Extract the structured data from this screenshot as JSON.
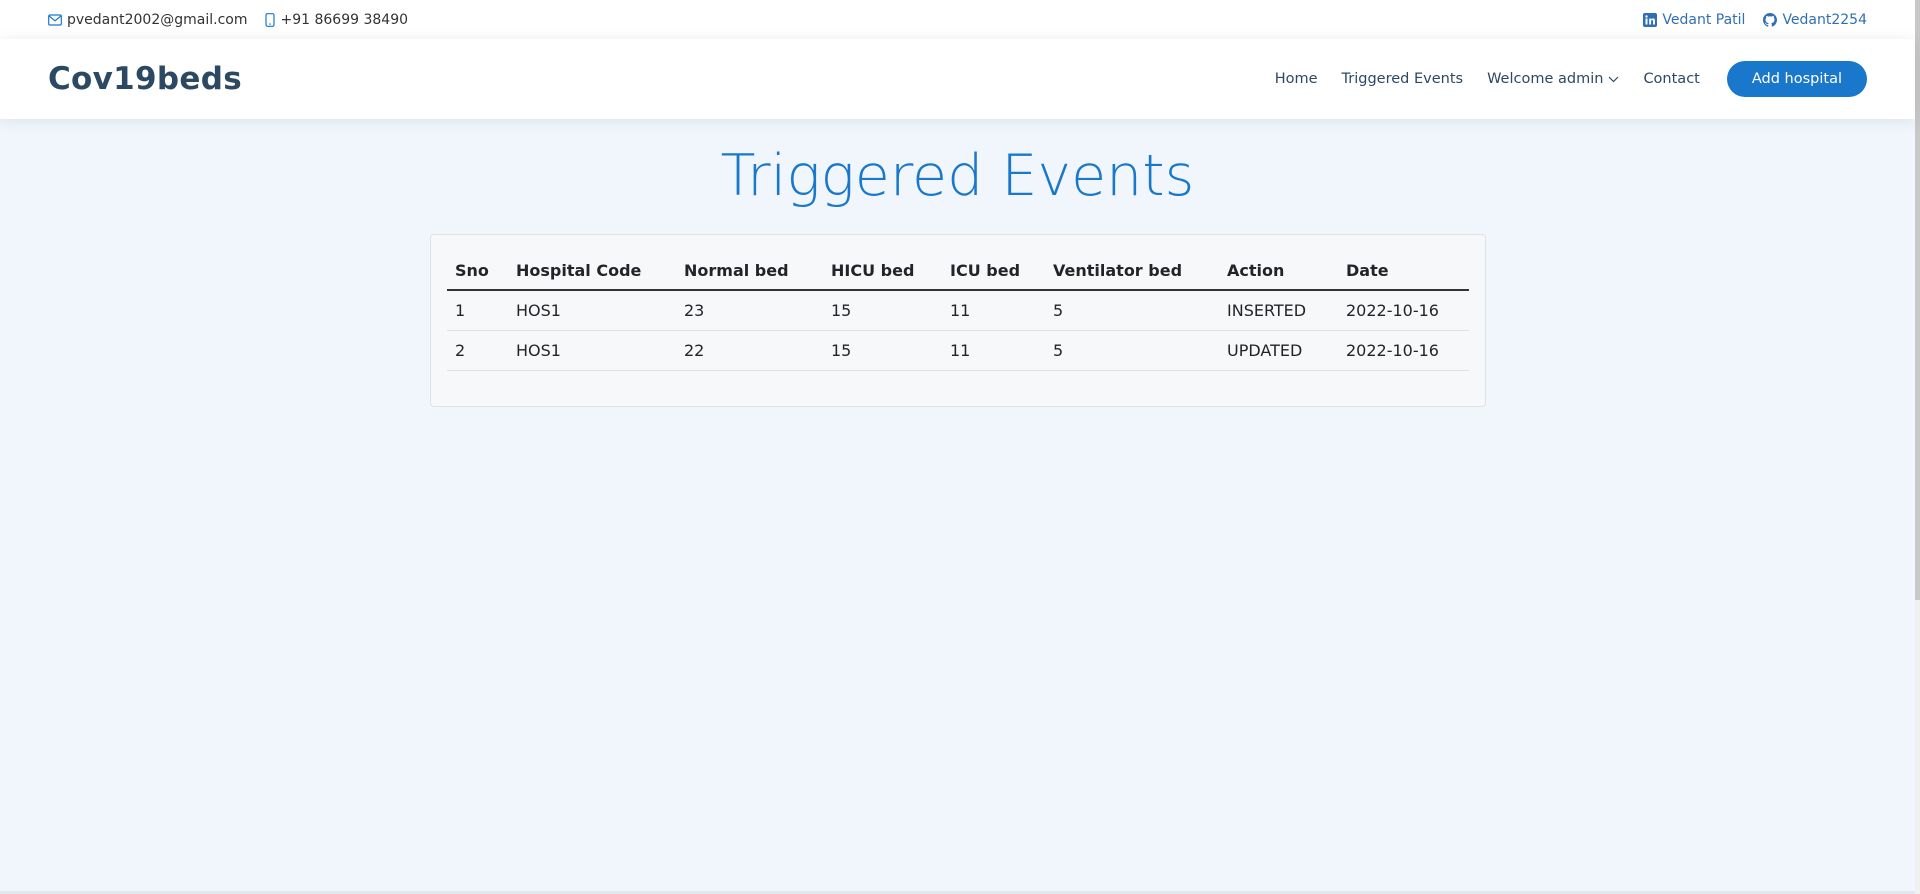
{
  "topbar": {
    "email": "pvedant2002@gmail.com",
    "phone": "+91 86699 38490",
    "linkedin": "Vedant Patil",
    "github": "Vedant2254"
  },
  "header": {
    "logo": "Cov19beds",
    "nav": {
      "home": "Home",
      "triggered": "Triggered Events",
      "welcome": "Welcome admin",
      "contact": "Contact",
      "add_hospital": "Add hospital"
    }
  },
  "main": {
    "title": "Triggered Events",
    "table": {
      "headers": [
        "Sno",
        "Hospital Code",
        "Normal bed",
        "HICU bed",
        "ICU bed",
        "Ventilator bed",
        "Action",
        "Date"
      ],
      "rows": [
        [
          "1",
          "HOS1",
          "23",
          "15",
          "11",
          "5",
          "INSERTED",
          "2022-10-16"
        ],
        [
          "2",
          "HOS1",
          "22",
          "15",
          "11",
          "5",
          "UPDATED",
          "2022-10-16"
        ]
      ]
    }
  },
  "icons": {
    "email": "envelope-icon",
    "phone": "phone-icon",
    "linkedin": "linkedin-icon",
    "github": "github-icon",
    "dropdown": "chevron-down-icon"
  },
  "colors": {
    "accent": "#1977cc",
    "dark": "#2c4964",
    "background": "#f1f6fc"
  }
}
